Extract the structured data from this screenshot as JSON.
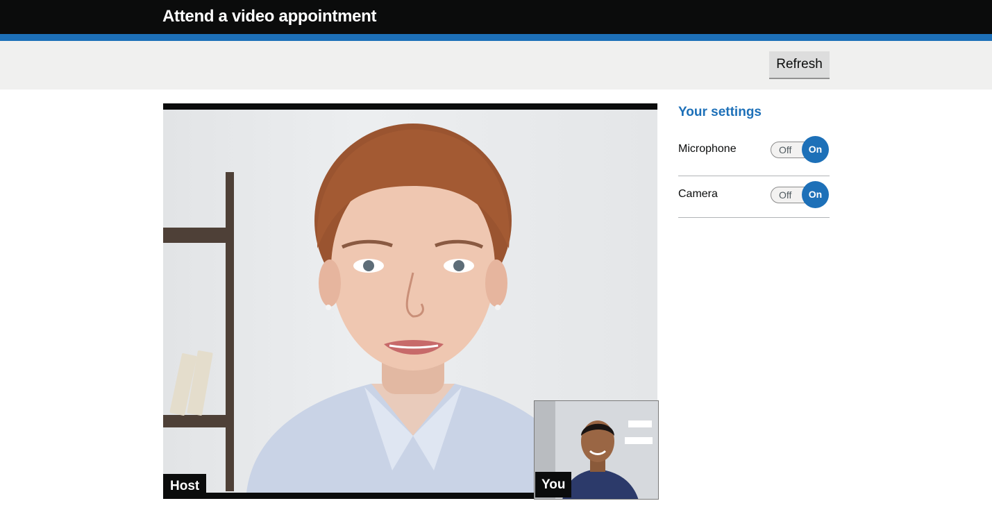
{
  "header": {
    "title": "Attend a video appointment"
  },
  "toolbar": {
    "refresh_label": "Refresh"
  },
  "video": {
    "host_label": "Host",
    "self_label": "You"
  },
  "settings": {
    "title": "Your settings",
    "items": [
      {
        "label": "Microphone",
        "off_label": "Off",
        "on_label": "On",
        "state": "on"
      },
      {
        "label": "Camera",
        "off_label": "Off",
        "on_label": "On",
        "state": "on"
      }
    ]
  },
  "colors": {
    "header_bg": "#0b0c0c",
    "accent_blue": "#1d70b8",
    "toolbar_bg": "#f0f0ef"
  }
}
